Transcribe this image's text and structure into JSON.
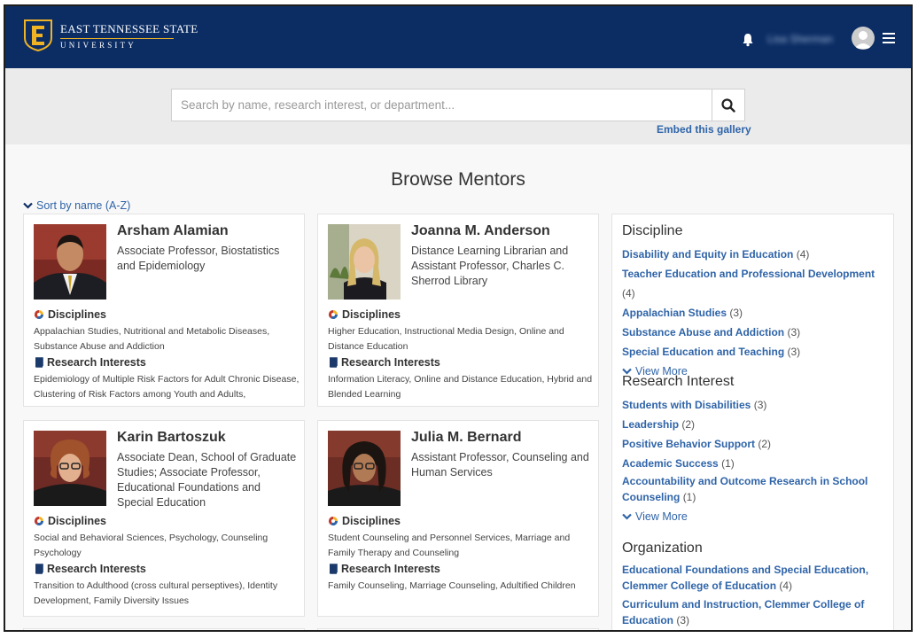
{
  "header": {
    "logo_line1": "EAST TENNESSEE STATE",
    "logo_line2": "UNIVERSITY",
    "username": "Lisa Sherman",
    "icons": {
      "bell": "bell-icon",
      "avatar": "user-avatar-icon",
      "menu": "hamburger-menu-icon"
    },
    "colors": {
      "navy": "#0b2d64",
      "gold": "#f0b323"
    }
  },
  "search": {
    "placeholder": "Search by name, research interest, or department...",
    "value": "",
    "embed_link": "Embed this gallery"
  },
  "main": {
    "title": "Browse Mentors",
    "sort_label": "Sort by name (A-Z)"
  },
  "mentors": [
    {
      "name": "Arsham Alamian",
      "title": "Associate Professor, Biostatistics and Epidemiology",
      "disciplines_label": "Disciplines",
      "disciplines": "Appalachian Studies, Nutritional and Metabolic Diseases, Substance Abuse and Addiction",
      "interests_label": "Research Interests",
      "interests": "Epidemiology of Multiple Risk Factors for Adult Chronic Disease, Clustering of Risk Factors among Youth and Adults,"
    },
    {
      "name": "Joanna M. Anderson",
      "title": "Distance Learning Librarian and Assistant Professor, Charles C. Sherrod Library",
      "disciplines_label": "Disciplines",
      "disciplines": "Higher Education, Instructional Media Design, Online and Distance Education",
      "interests_label": "Research Interests",
      "interests": "Information Literacy, Online and Distance Education, Hybrid and Blended Learning"
    },
    {
      "name": "Karin Bartoszuk",
      "title": "Associate Dean, School of Graduate Studies; Associate Professor, Educational Foundations and Special Education",
      "disciplines_label": "Disciplines",
      "disciplines": "Social and Behavioral Sciences, Psychology, Counseling Psychology",
      "interests_label": "Research Interests",
      "interests": "Transition to Adulthood (cross cultural perseptives), Identity Development, Family Diversity Issues"
    },
    {
      "name": "Julia M. Bernard",
      "title": "Assistant Professor, Counseling and Human Services",
      "disciplines_label": "Disciplines",
      "disciplines": "Student Counseling and Personnel Services, Marriage and Family Therapy and Counseling",
      "interests_label": "Research Interests",
      "interests": "Family Counseling, Marriage Counseling, Adultified Children"
    }
  ],
  "facets": {
    "discipline": {
      "heading": "Discipline",
      "items": [
        {
          "label": "Disability and Equity in Education",
          "count": "(4)"
        },
        {
          "label": "Teacher Education and Professional Development",
          "count": "(4)"
        },
        {
          "label": "Appalachian Studies",
          "count": "(3)"
        },
        {
          "label": "Substance Abuse and Addiction",
          "count": "(3)"
        },
        {
          "label": "Special Education and Teaching",
          "count": "(3)"
        }
      ],
      "view_more": "View More"
    },
    "research": {
      "heading": "Research Interest",
      "items": [
        {
          "label": "Students with Disabilities",
          "count": "(3)"
        },
        {
          "label": "Leadership",
          "count": "(2)"
        },
        {
          "label": "Positive Behavior Support",
          "count": "(2)"
        },
        {
          "label": "Academic Success",
          "count": "(1)"
        },
        {
          "label": "Accountability and Outcome Research in School Counseling",
          "count": "(1)"
        }
      ],
      "view_more": "View More"
    },
    "organization": {
      "heading": "Organization",
      "items": [
        {
          "label": "Educational Foundations and Special Education, Clemmer College of Education",
          "count": "(4)"
        },
        {
          "label": "Curriculum and Instruction, Clemmer College of Education",
          "count": "(3)"
        }
      ]
    }
  }
}
